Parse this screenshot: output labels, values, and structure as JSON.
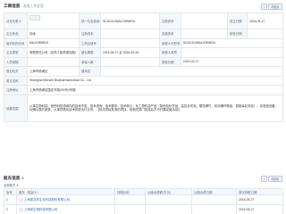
{
  "header": {
    "title": "工商信息",
    "link": "查看工商变更",
    "share_label": "",
    "save_label": "存图片"
  },
  "info": {
    "rows": [
      [
        "法定代表人",
        "",
        "统一社会信用代码",
        "91310110MA1G9B5E0L",
        "注册资本",
        "",
        "成立日期",
        "2016-05-27"
      ],
      [
        "企业状态",
        "存续",
        "注册资本",
        "",
        "实缴资本",
        "",
        "核准日期",
        ""
      ],
      [
        "组织机构代码",
        "MA1G9B5E0L",
        "工商注册号",
        "",
        "纳税人识别号",
        "91310110MA1G9B5E0L",
        "",
        ""
      ],
      [
        "企业类型",
        "有限责任公司（自然人投资或控股）",
        "营业期限",
        "2016-05-27 至 2036-05-26",
        "纳税人资质",
        "",
        "",
        ""
      ],
      [
        "人员规模",
        "",
        "参保人数",
        "",
        "核准日期",
        "2020-03-27",
        "",
        ""
      ],
      [
        "登记机关",
        "上海市杨浦区",
        "曾用名",
        "",
        "",
        "",
        "",
        ""
      ],
      [
        "英文名称",
        "Shanghai Michael Biopharmaceutical Co., Ltd.",
        "",
        "",
        "",
        "",
        "",
        ""
      ],
      [
        "注册地址",
        "上海市杨浦区国定东路200号4号楼",
        "",
        "",
        "",
        "",
        "",
        ""
      ],
      [
        "经营范围",
        "从事生物科技、医药科技领域内的技术开发、技术咨询、技术服务、技术转让，化工原料及产品（除危险化学品、监控化学品、烟花爆竹、民用爆炸物品、易制毒化学品）、实验室设备、仪器仪表的销售，从事货物及技术的进出口业务。【依法须经批准的项目，经相关部门批准后方可开展经营活动】",
        "",
        "",
        "",
        "",
        "",
        ""
      ]
    ]
  },
  "section2": {
    "title": "股东信息",
    "count": "3",
    "filter_label": "全部股东",
    "share_label": "",
    "save_label": "存图片",
    "columns": [
      "序号",
      "股东（发起人）",
      "持股比例",
      "认缴出资额(万元)",
      "认缴出资日期",
      "首次持股日期"
    ],
    "rows": [
      [
        "1",
        "上海麦克林生化科技股份有限公司",
        "",
        "",
        "",
        "2016-05-27"
      ],
      [
        "2",
        "上海某生物科技有限公司",
        "",
        "",
        "",
        "2016-05-27"
      ]
    ]
  }
}
